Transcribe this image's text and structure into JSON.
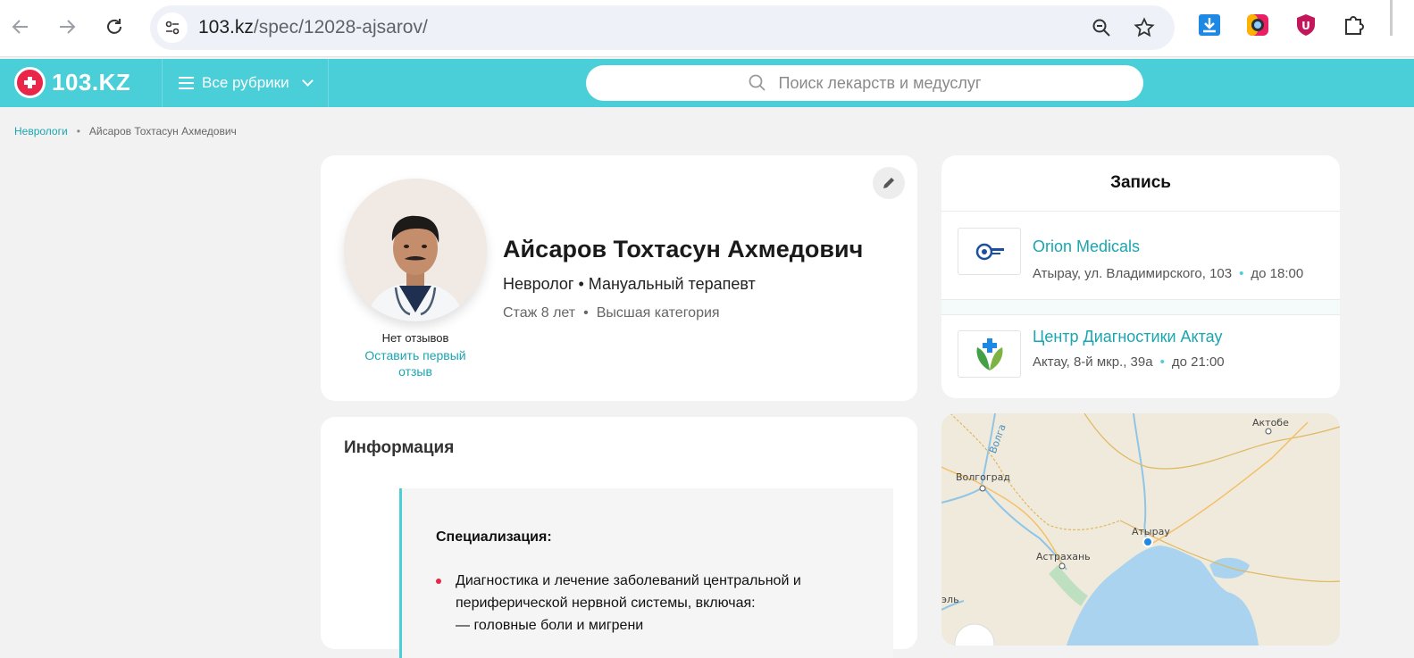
{
  "browser": {
    "url_host": "103.kz",
    "url_path": "/spec/12028-ajsarov/"
  },
  "header": {
    "logo_text": "103.KZ",
    "rubrics_label": "Все рубрики",
    "search_placeholder": "Поиск лекарств и медуслуг"
  },
  "breadcrumb": {
    "parent": "Неврологи",
    "separator": "•",
    "current": "Айсаров Тохтасун Ахмедович"
  },
  "profile": {
    "name": "Айсаров Тохтасун Ахмедович",
    "specialties": "Невролог • Мануальный терапевт",
    "experience": "Стаж 8 лет",
    "meta_separator": "•",
    "category": "Высшая категория",
    "no_reviews": "Нет отзывов",
    "leave_review": "Оставить первый отзыв"
  },
  "info": {
    "title": "Информация",
    "subtitle": "Специализация:",
    "bullet_line1": "Диагностика и лечение заболеваний центральной и",
    "bullet_line2": "периферической нервной системы, включая:",
    "bullet_line3": "— головные боли и мигрени"
  },
  "booking": {
    "title": "Запись",
    "clinics": [
      {
        "name": "Orion Medicals",
        "address": "Атырау, ул. Владимирского, 103",
        "hours": "до 18:00"
      },
      {
        "name": "Центр Диагностики Актау",
        "address": "Актау, 8-й мкр., 39а",
        "hours": "до 21:00"
      }
    ],
    "dot": "•"
  },
  "map": {
    "labels": [
      "Волгоград",
      "Астрахань",
      "Атырау",
      "Актобе",
      "Волга",
      "эль"
    ]
  },
  "colors": {
    "accent": "#4acfd9",
    "link": "#1aa6b0",
    "brand_red": "#e9254a"
  }
}
